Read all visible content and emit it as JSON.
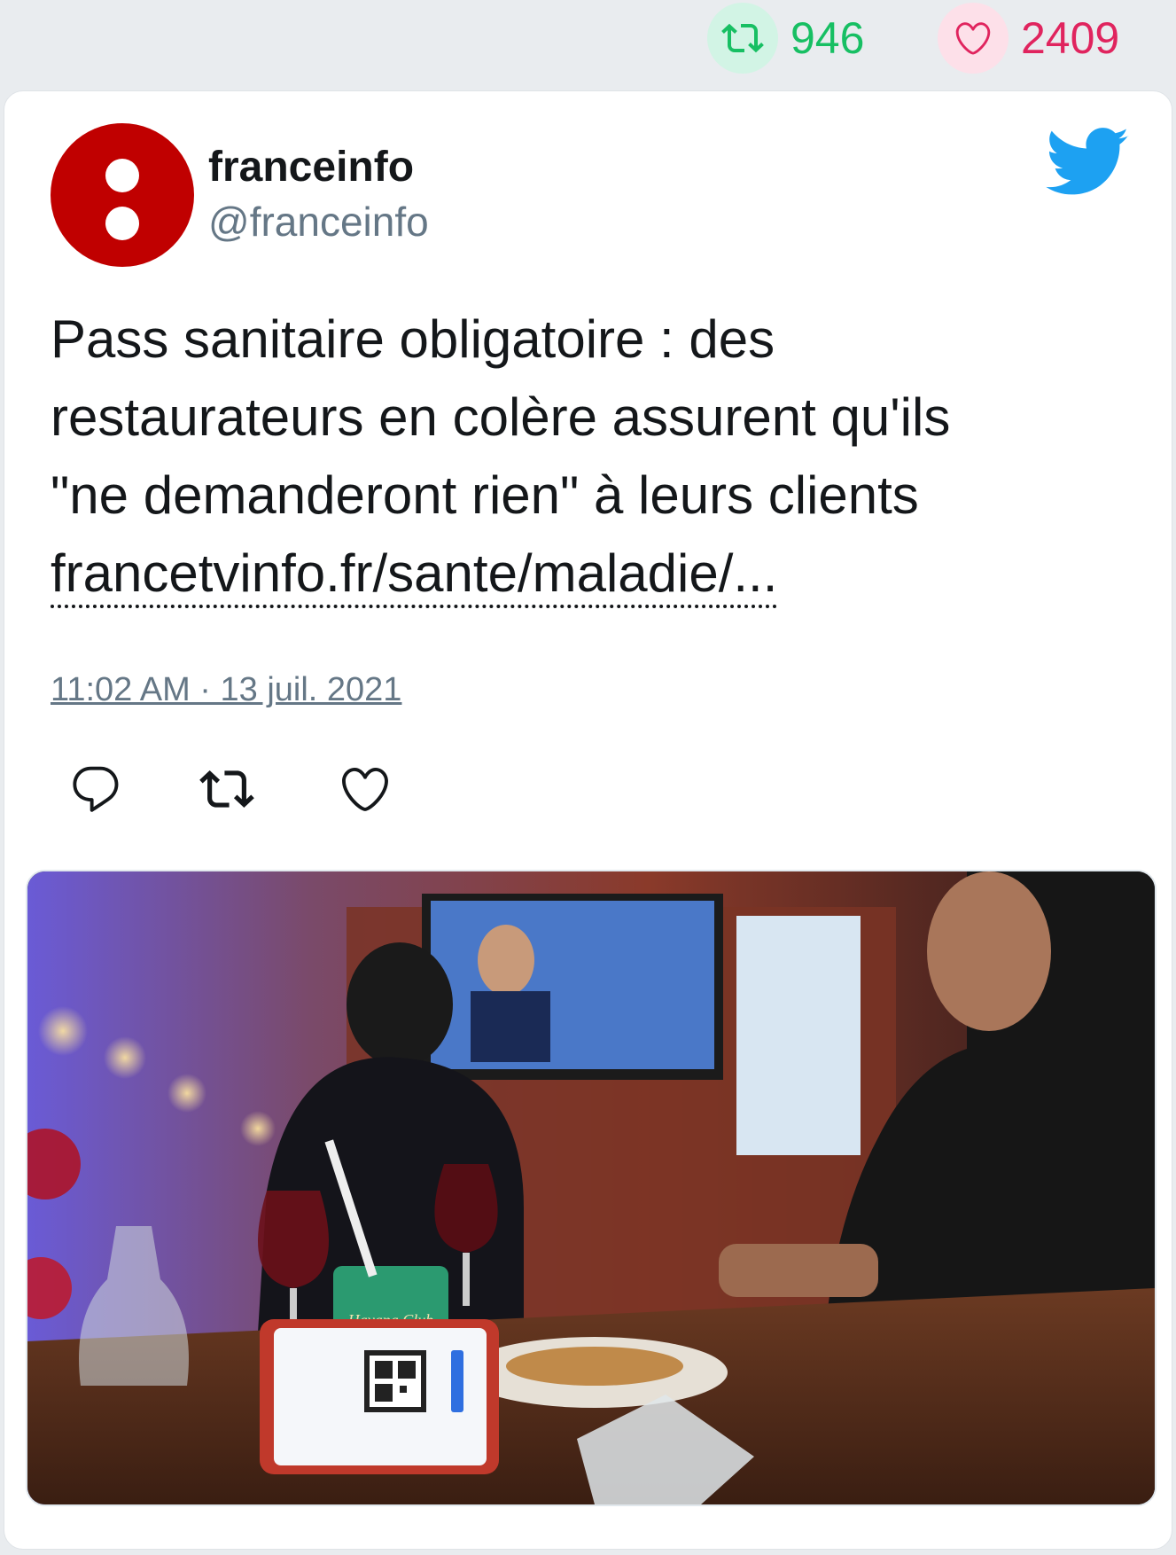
{
  "stats": {
    "retweets": "946",
    "likes": "2409",
    "retweet_icon": "retweet-icon",
    "like_icon": "heart-icon"
  },
  "tweet": {
    "author_name": "franceinfo",
    "author_handle": "@franceinfo",
    "text_lines": [
      "Pass sanitaire obligatoire : des",
      "restaurateurs en colère assurent qu'ils",
      "\"ne demanderont rien\" à leurs clients"
    ],
    "link_text": "francetvinfo.fr/sante/maladie/...",
    "timestamp": "11:02 AM · 13 juil. 2021",
    "actions": [
      "reply-icon",
      "retweet-icon",
      "heart-icon"
    ],
    "media": {
      "description_icon": "photo-restaurant",
      "bottle_label": "Havana Club"
    }
  },
  "colors": {
    "retweet_green": "#17bf63",
    "like_red": "#e0245e",
    "twitter_blue": "#1da1f2",
    "avatar_red": "#c00000",
    "muted_text": "#657786"
  }
}
